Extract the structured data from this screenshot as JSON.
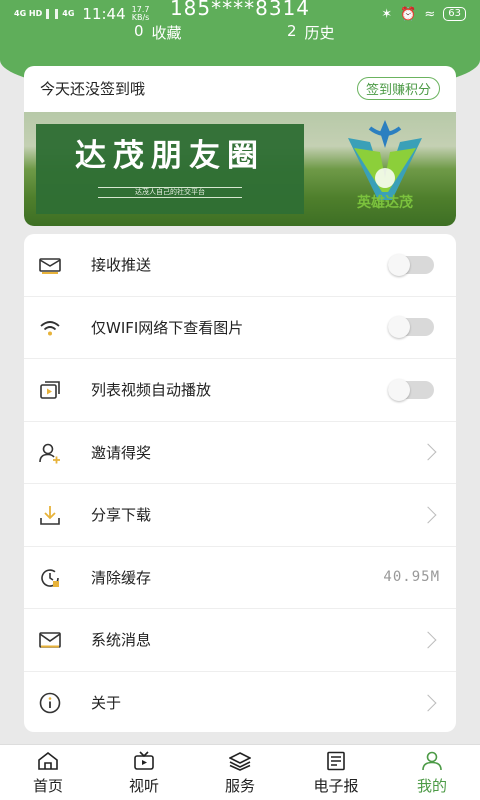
{
  "status_bar": {
    "network_1": "4G HD",
    "network_2": "4G",
    "time": "11:44",
    "speed_value": "17.7",
    "speed_unit": "KB/s",
    "battery": "63"
  },
  "profile": {
    "phone": "185****8314",
    "favorites_count": "0",
    "favorites_label": "收藏",
    "history_count": "2",
    "history_label": "历史"
  },
  "signin": {
    "text": "今天还没签到哦",
    "button": "签到赚积分"
  },
  "banner": {
    "title": "达茂朋友圈",
    "subtitle": "达茂人自己的社交平台",
    "logo_text": "英雄达茂"
  },
  "menu": {
    "items": [
      {
        "label": "接收推送",
        "type": "toggle",
        "on": false,
        "icon": "mail-bell-icon"
      },
      {
        "label": "仅WIFI网络下查看图片",
        "type": "toggle",
        "on": false,
        "icon": "wifi-icon"
      },
      {
        "label": "列表视频自动播放",
        "type": "toggle",
        "on": false,
        "icon": "video-play-icon"
      },
      {
        "label": "邀请得奖",
        "type": "link",
        "icon": "invite-user-icon"
      },
      {
        "label": "分享下载",
        "type": "link",
        "icon": "download-icon"
      },
      {
        "label": "清除缓存",
        "type": "value",
        "value": "40.95M",
        "icon": "clear-cache-icon"
      },
      {
        "label": "系统消息",
        "type": "link",
        "icon": "message-icon"
      },
      {
        "label": "关于",
        "type": "link",
        "icon": "info-icon"
      }
    ]
  },
  "tabbar": {
    "items": [
      {
        "label": "首页",
        "icon": "home-icon"
      },
      {
        "label": "视听",
        "icon": "tv-icon"
      },
      {
        "label": "服务",
        "icon": "layers-icon"
      },
      {
        "label": "电子报",
        "icon": "newspaper-icon"
      },
      {
        "label": "我的",
        "icon": "user-icon",
        "active": true
      }
    ]
  },
  "colors": {
    "brand_green": "#5fae5a",
    "active_green": "#4c9a46"
  }
}
